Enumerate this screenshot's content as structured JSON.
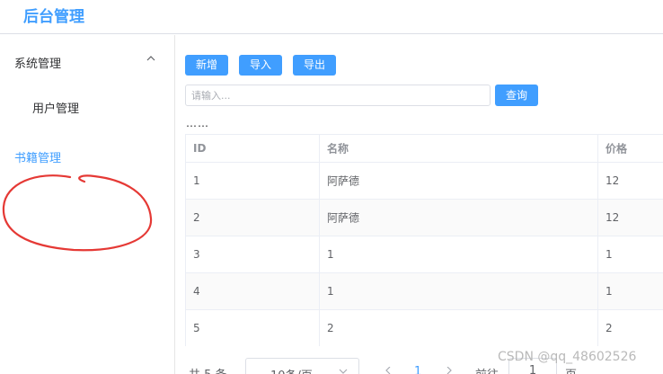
{
  "header": {
    "title": "后台管理"
  },
  "sidebar": {
    "group_label": "系统管理",
    "group_icon": "chevron-up-icon",
    "items": [
      {
        "label": "用户管理"
      },
      {
        "label": "书籍管理"
      }
    ],
    "active_color": "#409eff"
  },
  "toolbar": {
    "add_label": "新增",
    "import_label": "导入",
    "export_label": "导出",
    "search_placeholder": "请输入...",
    "search_label": "查询",
    "ellipsis": "……"
  },
  "table": {
    "columns": [
      "ID",
      "名称",
      "价格"
    ],
    "rows": [
      [
        "1",
        "阿萨德",
        "12"
      ],
      [
        "2",
        "阿萨德",
        "12"
      ],
      [
        "3",
        "1",
        "1"
      ],
      [
        "4",
        "1",
        "1"
      ],
      [
        "5",
        "2",
        "2"
      ]
    ]
  },
  "pagination": {
    "total_text": "共 5 条",
    "page_size": "10条/页",
    "current_page": "1",
    "goto_label": "前往",
    "jump_value": "1",
    "page_word": "页"
  },
  "watermark": "CSDN @qq_48602526",
  "colors": {
    "accent": "#409eff",
    "annotation": "#e53935"
  }
}
